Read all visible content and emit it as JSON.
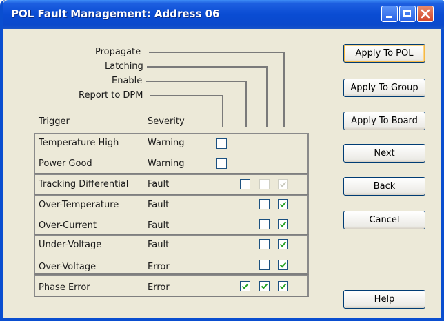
{
  "window": {
    "title": "POL Fault Management: Address 06",
    "controls": {
      "minimize": "minimize",
      "maximize": "maximize",
      "close": "close"
    }
  },
  "columns": {
    "propagate": "Propagate",
    "latching": "Latching",
    "enable": "Enable",
    "report_to_dpm": "Report to DPM",
    "trigger": "Trigger",
    "severity": "Severity"
  },
  "rows": [
    {
      "trigger": "Temperature High",
      "severity": "Warning",
      "report": false
    },
    {
      "trigger": "Power Good",
      "severity": "Warning",
      "report": false
    },
    {
      "trigger": "Tracking Differential",
      "severity": "Fault",
      "report": false,
      "enable": false,
      "latching": true
    },
    {
      "trigger": "Over-Temperature",
      "severity": "Fault",
      "latching": false,
      "propagate": true
    },
    {
      "trigger": "Over-Current",
      "severity": "Fault",
      "latching": false,
      "propagate": true
    },
    {
      "trigger": "Under-Voltage",
      "severity": "Fault",
      "latching": false,
      "propagate": true
    },
    {
      "trigger": "Over-Voltage",
      "severity": "Error",
      "latching": false,
      "propagate": true
    },
    {
      "trigger": "Phase Error",
      "severity": "Error",
      "enable": true,
      "latching": true,
      "propagate": true
    }
  ],
  "buttons": {
    "apply_to_pol": "Apply To POL",
    "apply_to_group": "Apply To Group",
    "apply_to_board": "Apply To Board",
    "next": "Next",
    "back": "Back",
    "cancel": "Cancel",
    "help": "Help"
  }
}
